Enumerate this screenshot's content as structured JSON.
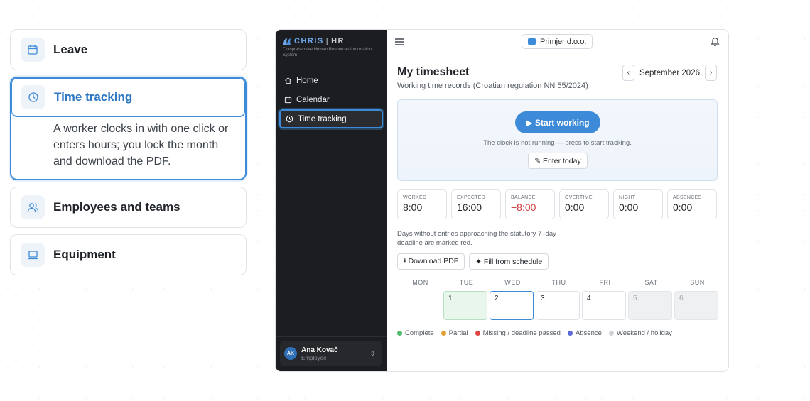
{
  "features": [
    {
      "title": "Leave",
      "icon": "calendar-icon",
      "active": false
    },
    {
      "title": "Time tracking",
      "icon": "clock-icon",
      "active": true,
      "description": "A worker clocks in with one click or enters hours; you lock the month and download the PDF."
    },
    {
      "title": "Employees and teams",
      "icon": "users-icon",
      "active": false
    },
    {
      "title": "Equipment",
      "icon": "laptop-icon",
      "active": false
    }
  ],
  "app": {
    "brand": {
      "name": "CHRIS",
      "sep": "|",
      "suffix": "HR",
      "subtitle": "Comprehensive Human Resources Information System"
    },
    "nav": [
      {
        "label": "Home",
        "icon": "home-icon"
      },
      {
        "label": "Calendar",
        "icon": "calendar-icon"
      },
      {
        "label": "Time tracking",
        "icon": "clock-icon",
        "active": true
      }
    ],
    "user": {
      "initials": "AK",
      "name": "Ana Kovač",
      "role": "Employee"
    },
    "company": "Primjer d.o.o.",
    "title": "My timesheet",
    "subtitle": "Working time records (Croatian regulation NN 55/2024)",
    "month": "September 2026",
    "prev": "‹",
    "next": "›",
    "clock": {
      "start_label": "▶ Start working",
      "message": "The clock is not running — press to start tracking.",
      "enter_label": "✎ Enter today"
    },
    "stats": [
      {
        "label": "WORKED",
        "value": "8:00"
      },
      {
        "label": "EXPECTED",
        "value": "16:00"
      },
      {
        "label": "BALANCE",
        "value": "−8:00",
        "negative": true
      },
      {
        "label": "OVERTIME",
        "value": "0:00"
      },
      {
        "label": "NIGHT",
        "value": "0:00"
      },
      {
        "label": "ABSENCES",
        "value": "0:00"
      }
    ],
    "note": "Days without entries approaching the statutory 7–day deadline are marked red.",
    "actions": {
      "download": "⭳ Download PDF",
      "fill": "✦ Fill from schedule"
    },
    "weekdays": [
      "MON",
      "TUE",
      "WED",
      "THU",
      "FRI",
      "SAT",
      "SUN"
    ],
    "days": [
      {
        "day": "",
        "state": "blank"
      },
      {
        "day": "1",
        "state": "complete"
      },
      {
        "day": "2",
        "state": "today"
      },
      {
        "day": "3",
        "state": "normal"
      },
      {
        "day": "4",
        "state": "normal"
      },
      {
        "day": "5",
        "state": "weekend"
      },
      {
        "day": "6",
        "state": "weekend"
      }
    ],
    "legend": [
      {
        "label": "Complete",
        "color": "#4cbb6a"
      },
      {
        "label": "Partial",
        "color": "#e0a030"
      },
      {
        "label": "Missing / deadline passed",
        "color": "#de4545"
      },
      {
        "label": "Absence",
        "color": "#5b6ad6"
      },
      {
        "label": "Weekend / holiday",
        "color": "#cdd1d6"
      }
    ]
  }
}
